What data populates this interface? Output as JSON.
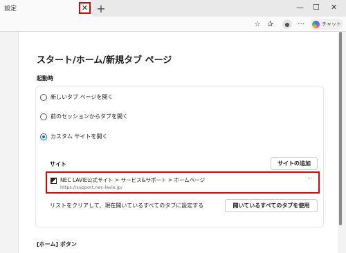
{
  "tab": {
    "title": "設定",
    "close_symbol": "✕",
    "new_tab_symbol": "+"
  },
  "window": {
    "minimize": "—",
    "maximize": "☐",
    "close": "✕"
  },
  "toolbar": {
    "chat_label": "チャット",
    "more_symbol": "···"
  },
  "page": {
    "title": "スタート/ホーム/新規タブ ページ",
    "startup_label": "起動時",
    "options": [
      {
        "label": "新しいタブ ページを開く",
        "selected": false
      },
      {
        "label": "前のセッションからタブを開く",
        "selected": false
      },
      {
        "label": "カスタム サイトを開く",
        "selected": true
      }
    ],
    "sites_label": "サイト",
    "add_site_button": "サイトの追加",
    "site": {
      "name": "NEC LAVIE公式サイト > サービス&サポート > ホームページ",
      "url": "https://support.nec-lavie.jp/",
      "more": "···"
    },
    "clear_text": "リストをクリアして、現在開いているすべてのタブに設定する",
    "use_open_tabs_button": "開いているすべてのタブを使用",
    "home_button_label": "[ホーム] ボタン"
  }
}
